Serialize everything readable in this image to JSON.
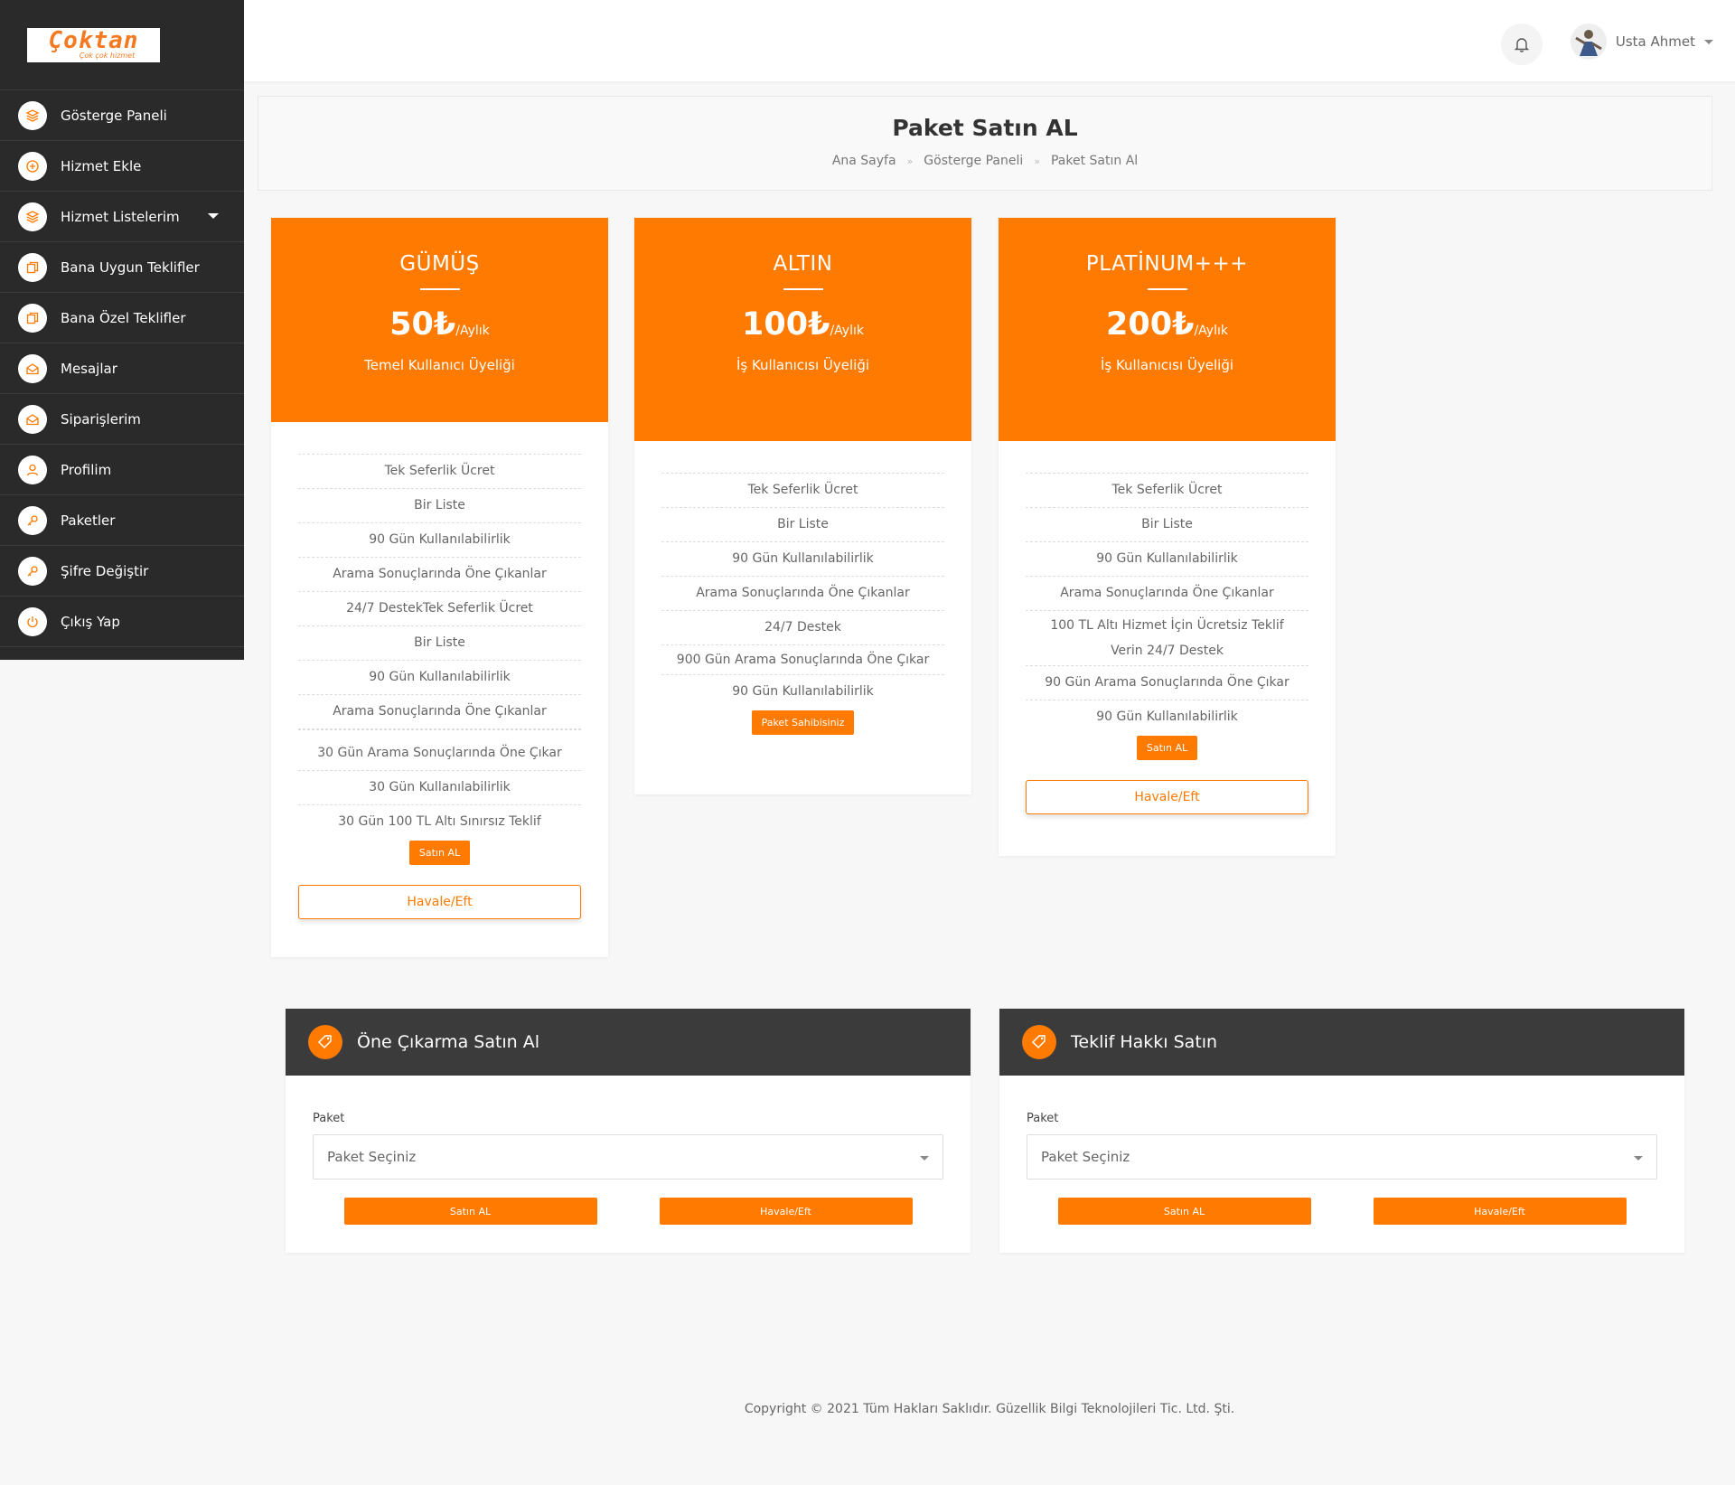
{
  "logo": {
    "text": "Çoktan",
    "tagline": "Çok çok hizmet"
  },
  "sidebar": {
    "items": [
      {
        "label": "Gösterge Paneli",
        "icon": "layers-icon"
      },
      {
        "label": "Hizmet Ekle",
        "icon": "plus-circle-icon"
      },
      {
        "label": "Hizmet Listelerim",
        "icon": "layers-icon"
      },
      {
        "label": "Bana Uygun Teklifler",
        "icon": "copy-icon"
      },
      {
        "label": "Bana Özel Teklifler",
        "icon": "copy-icon"
      },
      {
        "label": "Mesajlar",
        "icon": "mail-open-icon"
      },
      {
        "label": "Siparişlerim",
        "icon": "mail-open-icon"
      },
      {
        "label": "Profilim",
        "icon": "user-icon"
      },
      {
        "label": "Paketler",
        "icon": "key-icon"
      },
      {
        "label": "Şifre Değiştir",
        "icon": "key-icon"
      },
      {
        "label": "Çıkış Yap",
        "icon": "power-icon"
      }
    ]
  },
  "header": {
    "user_name": "Usta Ahmet"
  },
  "page": {
    "title": "Paket Satın AL",
    "breadcrumb": [
      "Ana Sayfa",
      "Gösterge Paneli",
      "Paket Satın Al"
    ]
  },
  "plans": [
    {
      "name": "GÜMÜŞ",
      "price": "50₺",
      "period": "/Aylık",
      "desc": "Temel Kullanıcı Üyeliği",
      "features": [
        "Tek Seferlik Ücret",
        "Bir Liste",
        "90 Gün Kullanılabilirlik",
        "Arama Sonuçlarında Öne Çıkanlar",
        "24/7 DestekTek Seferlik Ücret",
        "Bir Liste",
        "90 Gün Kullanılabilirlik",
        "Arama Sonuçlarında Öne Çıkanlar",
        "30 Gün Arama Sonuçlarında Öne Çıkar",
        "30 Gün Kullanılabilirlik",
        "30 Gün 100 TL Altı Sınırsız Teklif"
      ],
      "button": "Satın AL",
      "transfer": "Havale/Eft"
    },
    {
      "name": "ALTIN",
      "price": "100₺",
      "period": "/Aylık",
      "desc": "İş Kullanıcısı Üyeliği",
      "features": [
        "Tek Seferlik Ücret",
        "Bir Liste",
        "90 Gün Kullanılabilirlik",
        "Arama Sonuçlarında Öne Çıkanlar",
        "24/7 Destek",
        "900 Gün Arama Sonuçlarında Öne Çıkar",
        "90 Gün Kullanılabilirlik"
      ],
      "button": "Paket Sahibisiniz"
    },
    {
      "name": "PLATİNUM+++",
      "price": "200₺",
      "period": "/Aylık",
      "desc": "İş Kullanıcısı Üyeliği",
      "features": [
        "Tek Seferlik Ücret",
        "Bir Liste",
        "90 Gün Kullanılabilirlik",
        "Arama Sonuçlarında Öne Çıkanlar",
        "100 TL Altı Hizmet İçin Ücretsiz Teklif Verin 24/7 Destek",
        "90 Gün Arama Sonuçlarında Öne Çıkar",
        "90 Gün Kullanılabilirlik"
      ],
      "button": "Satın AL",
      "transfer": "Havale/Eft"
    }
  ],
  "panels": [
    {
      "title": "Öne Çıkarma Satın Al",
      "field_label": "Paket",
      "select_value": "Paket Seçiniz",
      "buy": "Satın AL",
      "transfer": "Havale/Eft"
    },
    {
      "title": "Teklif Hakkı Satın",
      "field_label": "Paket",
      "select_value": "Paket Seçiniz",
      "buy": "Satın AL",
      "transfer": "Havale/Eft"
    }
  ],
  "footer": {
    "text": "Copyright © 2021 Tüm Hakları Saklıdır. Güzellik Bilgi Teknolojileri Tic. Ltd. Şti."
  },
  "colors": {
    "accent": "#ff7a00",
    "sidebar": "#2a2a2a",
    "panel_head": "#3b3b3b"
  }
}
